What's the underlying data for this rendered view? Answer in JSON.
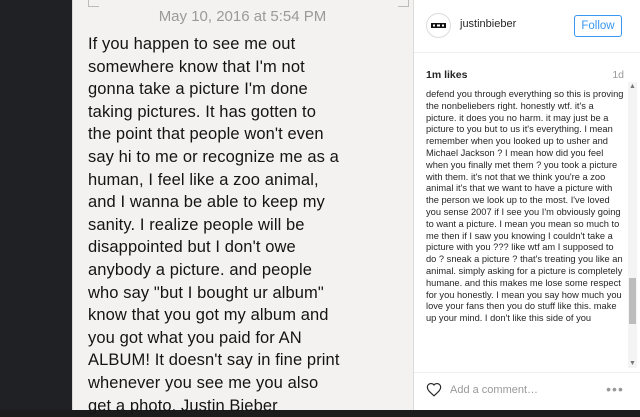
{
  "note": {
    "date": "May 10, 2016 at 5:54 PM",
    "text": "If you happen to see me out\nsomewhere know that I'm not\ngonna take a picture I'm done\ntaking pictures. It has gotten to\nthe point that people won't even\nsay hi to me or recognize me as a\nhuman, I feel like a zoo animal,\nand I wanna be able to keep my\nsanity. I realize people will be\ndisappointed but I don't owe\nanybody a picture. and people\nwho say \"but I bought ur album\"\nknow that you got my album and\nyou got what you paid for AN\nALBUM! It doesn't say in fine print\nwhenever you see me you also\nget a photo. Justin Bieber"
  },
  "post": {
    "username": "justinbieber",
    "follow_label": "Follow",
    "likes": "1m likes",
    "age": "1d",
    "comment": "defend you through everything so this is proving the nonbeliebers right. honestly wtf. it's a picture. it does you no harm. it may just be a picture to you but to us it's everything. I mean remember when you looked up to usher and Michael Jackson ? I mean how did you feel when you finally met them ? you took a picture with them. it's not that we think you're a zoo animal it's that we want to have a picture with the person we look up to the most. I've loved you sense 2007 if I see you I'm obviously going to want a picture. I mean you mean so much to me then if I saw you knowing I couldn't take a picture with you ??? like wtf am I supposed to do ? sneak a picture ? that's treating you like an animal. simply asking for a picture is completely humane. and this makes me lose some respect for you honestly. I mean you say how much you love your fans then you do stuff like this. make up your mind. I don't like this side of you",
    "add_comment_placeholder": "Add a comment…",
    "more_label": "•••"
  },
  "icons": {
    "heart": "heart-icon",
    "more": "more-options-icon",
    "avatar": "avatar-logo-icon"
  },
  "colors": {
    "accent": "#3897f0",
    "note_background": "#f3f2f0",
    "dark_background": "#1c1c1c"
  }
}
